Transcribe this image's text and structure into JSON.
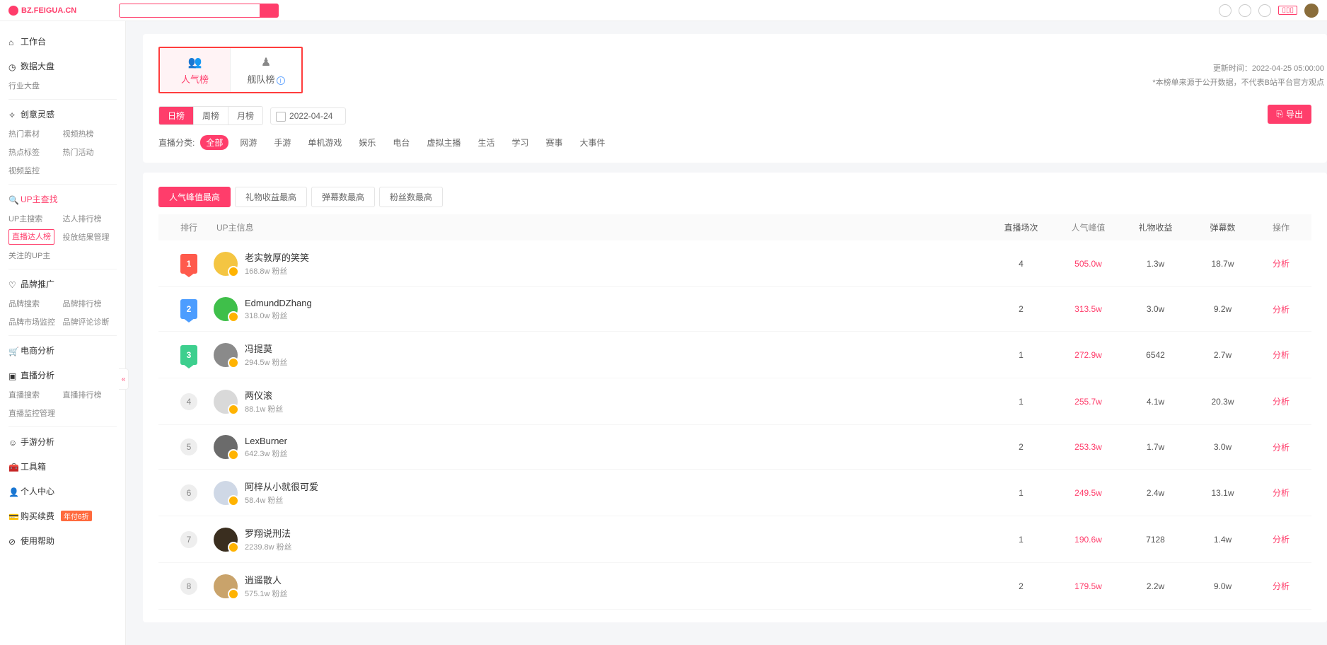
{
  "logo_text": "BZ.FEIGUA.CN",
  "header_tag": "",
  "sidebar": {
    "workbench": "工作台",
    "dashboard": {
      "title": "数据大盘",
      "items": [
        "行业大盘"
      ]
    },
    "creative": {
      "title": "创意灵感",
      "items": [
        "热门素材",
        "视频热榜",
        "热点标签",
        "热门活动",
        "视频监控"
      ]
    },
    "upsearch": {
      "title": "UP主查找",
      "items": [
        "UP主搜索",
        "达人排行榜",
        "直播达人榜",
        "投放结果管理",
        "关注的UP主"
      ]
    },
    "brand": {
      "title": "品牌推广",
      "items": [
        "品牌搜索",
        "品牌排行榜",
        "品牌市场监控",
        "品牌评论诊断"
      ]
    },
    "ecom": {
      "title": "电商分析"
    },
    "live": {
      "title": "直播分析",
      "items": [
        "直播搜索",
        "直播排行榜",
        "直播监控管理"
      ]
    },
    "mobile": {
      "title": "手游分析"
    },
    "tools": {
      "title": "工具箱"
    },
    "user": {
      "title": "个人中心"
    },
    "renew": {
      "title": "购买续费",
      "badge": "年付6折"
    },
    "help": {
      "title": "使用帮助"
    }
  },
  "rank_tabs": [
    {
      "label": "人气榜"
    },
    {
      "label": "舰队榜"
    }
  ],
  "update_time_label": "更新时间：",
  "update_time": "2022-04-25 05:00:00",
  "disclaimer": "*本榜单来源于公开数据，不代表B站平台官方观点",
  "period_tabs": [
    "日榜",
    "周榜",
    "月榜"
  ],
  "date_value": "2022-04-24",
  "export_label": "导出",
  "category_label": "直播分类:",
  "categories": [
    "全部",
    "网游",
    "手游",
    "单机游戏",
    "娱乐",
    "电台",
    "虚拟主播",
    "生活",
    "学习",
    "赛事",
    "大事件"
  ],
  "metric_tabs": [
    "人气峰值最高",
    "礼物收益最高",
    "弹幕数最高",
    "粉丝数最高"
  ],
  "columns": {
    "rank": "排行",
    "info": "UP主信息",
    "sessions": "直播场次",
    "peak": "人气峰值",
    "gift": "礼物收益",
    "danmu": "弹幕数",
    "op": "操作"
  },
  "fans_suffix": " 粉丝",
  "analyze": "分析",
  "rows": [
    {
      "rank": 1,
      "name": "老实敦厚的笑笑",
      "fans": "168.8w",
      "sessions": "4",
      "peak": "505.0w",
      "gift": "1.3w",
      "danmu": "18.7w",
      "avatar": "#f4c542"
    },
    {
      "rank": 2,
      "name": "EdmundDZhang",
      "fans": "318.0w",
      "sessions": "2",
      "peak": "313.5w",
      "gift": "3.0w",
      "danmu": "9.2w",
      "avatar": "#3fbf4a"
    },
    {
      "rank": 3,
      "name": "冯提莫",
      "fans": "294.5w",
      "sessions": "1",
      "peak": "272.9w",
      "gift": "6542",
      "danmu": "2.7w",
      "avatar": "#8a8a8a"
    },
    {
      "rank": 4,
      "name": "两仪滚",
      "fans": "88.1w",
      "sessions": "1",
      "peak": "255.7w",
      "gift": "4.1w",
      "danmu": "20.3w",
      "avatar": "#d9d9d9"
    },
    {
      "rank": 5,
      "name": "LexBurner",
      "fans": "642.3w",
      "sessions": "2",
      "peak": "253.3w",
      "gift": "1.7w",
      "danmu": "3.0w",
      "avatar": "#6b6b6b"
    },
    {
      "rank": 6,
      "name": "阿梓从小就很可爱",
      "fans": "58.4w",
      "sessions": "1",
      "peak": "249.5w",
      "gift": "2.4w",
      "danmu": "13.1w",
      "avatar": "#cfd8e6"
    },
    {
      "rank": 7,
      "name": "罗翔说刑法",
      "fans": "2239.8w",
      "sessions": "1",
      "peak": "190.6w",
      "gift": "7128",
      "danmu": "1.4w",
      "avatar": "#3a2e1f"
    },
    {
      "rank": 8,
      "name": "逍遥散人",
      "fans": "575.1w",
      "sessions": "2",
      "peak": "179.5w",
      "gift": "2.2w",
      "danmu": "9.0w",
      "avatar": "#c9a36b"
    }
  ]
}
